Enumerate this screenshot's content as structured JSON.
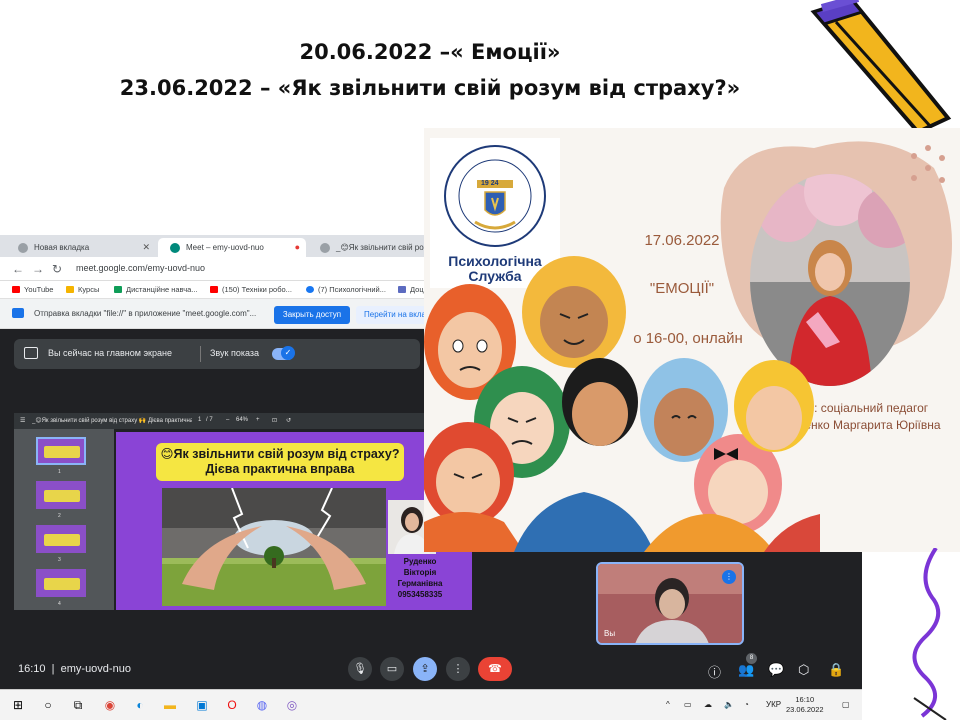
{
  "slide": {
    "title_line1": "20.06.2022 –« Емоції»",
    "title_line2": "23.06.2022 – «Як звільнити свій розум від страху?»"
  },
  "browser": {
    "tabs": [
      {
        "label": "Новая вкладка"
      },
      {
        "label": "Meet – emy-uovd-nuo"
      },
      {
        "label": "_😊Як звільнити свій розу"
      }
    ],
    "url": "meet.google.com/emy-uovd-nuo",
    "bookmarks": [
      "YouTube",
      "Курсы",
      "Дистанційне навча...",
      "(150) Техніки робо...",
      "(7) Психологічний...",
      "Доц"
    ],
    "infobar": {
      "text": "Отправка вкладки \"file://\" в приложение \"meet.google.com\"...",
      "share_button": "Закрыть доступ",
      "switch_button": "Перейти на вкла"
    }
  },
  "meet": {
    "presenting_text": "Вы сейчас на главном экране",
    "sound_label": "Звук показа",
    "meeting_time": "16:10",
    "meeting_code": "emy-uovd-nuo",
    "self_label": "Вы",
    "participants_badge": "8"
  },
  "pdf": {
    "filename": "_😊Як звільнити свій розум від страху 🙌 Дієва практична вправ...",
    "page": "1",
    "pages": "/ 7",
    "zoom": "64%",
    "thumb_numbers": [
      "1",
      "2",
      "3",
      "4"
    ],
    "slide_title1": "😊Як звільнити свій розум від страху?",
    "slide_title2": "Дієва практична вправа",
    "presenter_name1": "Руденко",
    "presenter_name2": "Вікторія",
    "presenter_name3": "Германівна",
    "presenter_phone": "0953458335"
  },
  "taskbar": {
    "lang": "УКР",
    "time": "16:10",
    "date": "23.06.2022"
  },
  "poster": {
    "logo_title1": "Психологічна",
    "logo_title2": "Служба",
    "logo_year": "19 24",
    "date": "17.06.2022",
    "event": "\"ЕМОЦІЇ\"",
    "time": "о 16-00, онлайн",
    "lead_line1": "Проводить: соціальний педагог",
    "lead_line2": "Чередниченко Маргарита Юріївна"
  }
}
